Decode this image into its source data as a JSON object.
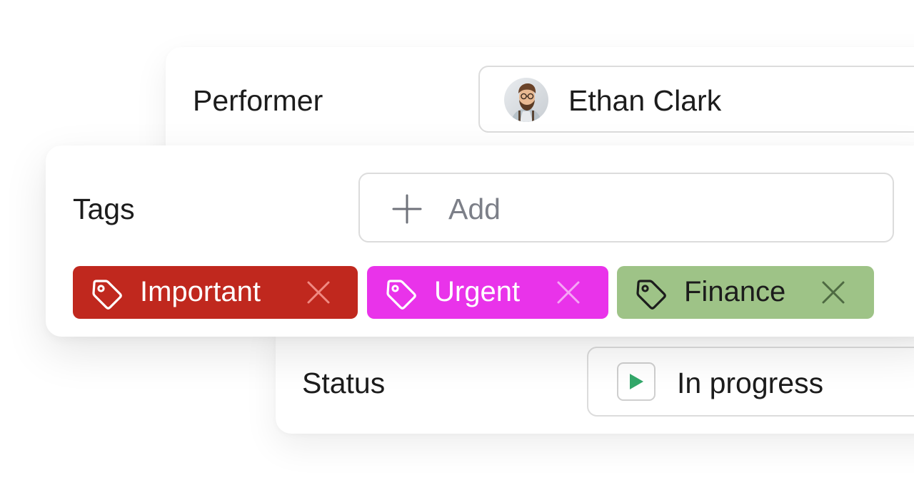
{
  "performer": {
    "label": "Performer",
    "name": "Ethan Clark"
  },
  "tags": {
    "label": "Tags",
    "add_placeholder": "Add",
    "items": [
      {
        "label": "Important",
        "bg": "#c0281e",
        "fg": "#ffffff",
        "remove_color": "#f08a82",
        "icon_color": "#ffffff"
      },
      {
        "label": "Urgent",
        "bg": "#e933ea",
        "fg": "#ffffff",
        "remove_color": "#f6a6f6",
        "icon_color": "#ffffff"
      },
      {
        "label": "Finance",
        "bg": "#9ec387",
        "fg": "#1c1c1c",
        "remove_color": "#4e6a42",
        "icon_color": "#1c1c1c"
      }
    ]
  },
  "status": {
    "label": "Status",
    "value": "In progress",
    "icon": "play-icon",
    "icon_color": "#33a86a"
  }
}
